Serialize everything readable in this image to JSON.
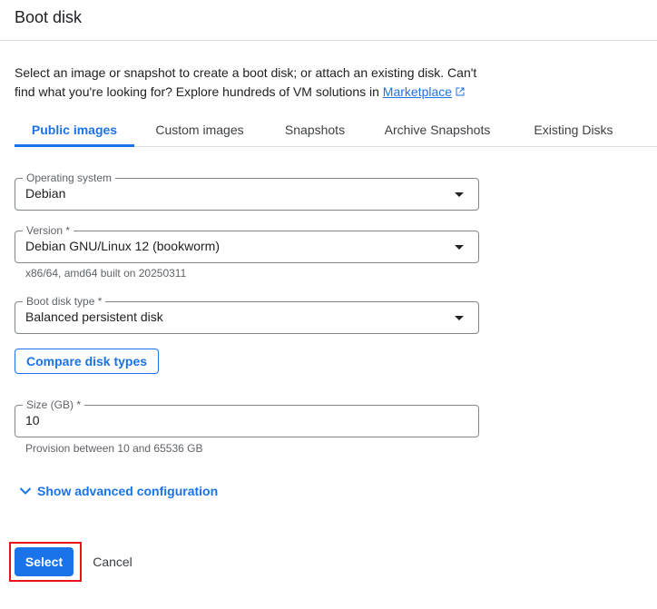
{
  "header": {
    "title": "Boot disk"
  },
  "intro": {
    "text": "Select an image or snapshot to create a boot disk; or attach an existing disk. Can't find what you're looking for? Explore hundreds of VM solutions in",
    "link_label": "Marketplace",
    "link_icon": "external-link-icon"
  },
  "tabs": [
    {
      "label": "Public images",
      "active": true
    },
    {
      "label": "Custom images",
      "active": false
    },
    {
      "label": "Snapshots",
      "active": false
    },
    {
      "label": "Archive Snapshots",
      "active": false
    },
    {
      "label": "Existing Disks",
      "active": false
    }
  ],
  "form": {
    "os": {
      "label": "Operating system",
      "value": "Debian"
    },
    "version": {
      "label": "Version *",
      "value": "Debian GNU/Linux 12 (bookworm)",
      "hint": "x86/64, amd64 built on 20250311"
    },
    "disk_type": {
      "label": "Boot disk type *",
      "value": "Balanced persistent disk"
    },
    "compare_button": "Compare disk types",
    "size": {
      "label": "Size (GB) *",
      "value": "10",
      "hint": "Provision between 10 and 65536 GB"
    },
    "advanced_label": "Show advanced configuration"
  },
  "actions": {
    "select": "Select",
    "cancel": "Cancel"
  },
  "colors": {
    "accent": "#1a73e8",
    "highlight": "#e8141b",
    "text": "#202124",
    "muted": "#5f6368",
    "divider": "#dadce0"
  }
}
